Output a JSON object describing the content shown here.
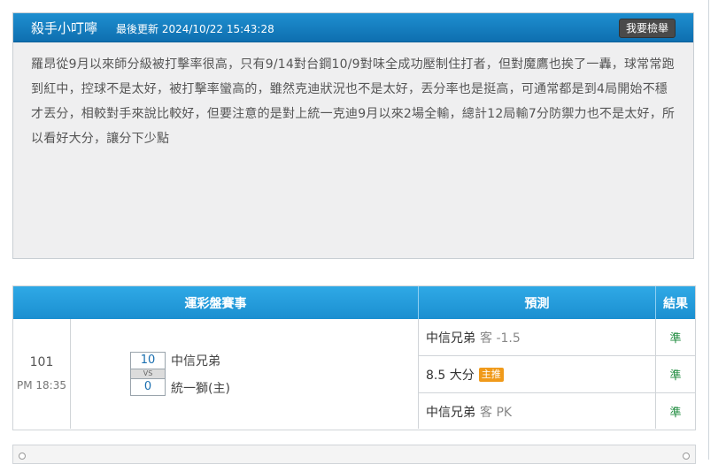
{
  "post": {
    "author": "殺手小叮嚀",
    "updated_label": "最後更新",
    "updated_time": "2024/10/22 15:43:28",
    "report_button": "我要檢舉",
    "content": "羅昂從9月以來師分級被打擊率很高，只有9/14對台鋼10/9對味全成功壓制住打者，但對魔鷹也挨了一轟，球常常跑到紅中，控球不是太好，被打擊率蠻高的，雖然克迪狀況也不是太好，丟分率也是挺高，可通常都是到4局開始不穩才丟分，相較對手來說比較好，但要注意的是對上統一克迪9月以來2場全輸，總計12局輸7分防禦力也不是太好，所以看好大分，讓分下少點"
  },
  "table": {
    "headers": {
      "event": "運彩盤賽事",
      "prediction": "預測",
      "result": "結果"
    },
    "game": {
      "number": "101",
      "time": "PM 18:35",
      "away_score": "10",
      "vs": "VS",
      "home_score": "0",
      "away_team": "中信兄弟",
      "home_team": "統一獅(主)"
    },
    "predictions": [
      {
        "pick": "中信兄弟",
        "line": "客 -1.5",
        "tag": ""
      },
      {
        "pick": "8.5 大分",
        "line": "",
        "tag": "主推"
      },
      {
        "pick": "中信兄弟",
        "line": "客 PK",
        "tag": ""
      }
    ],
    "results": [
      "準",
      "準",
      "準"
    ]
  },
  "colors": {
    "header_blue": "#1b8fd0",
    "win_green": "#1c8a3c",
    "tag_orange": "#f09a1a"
  }
}
